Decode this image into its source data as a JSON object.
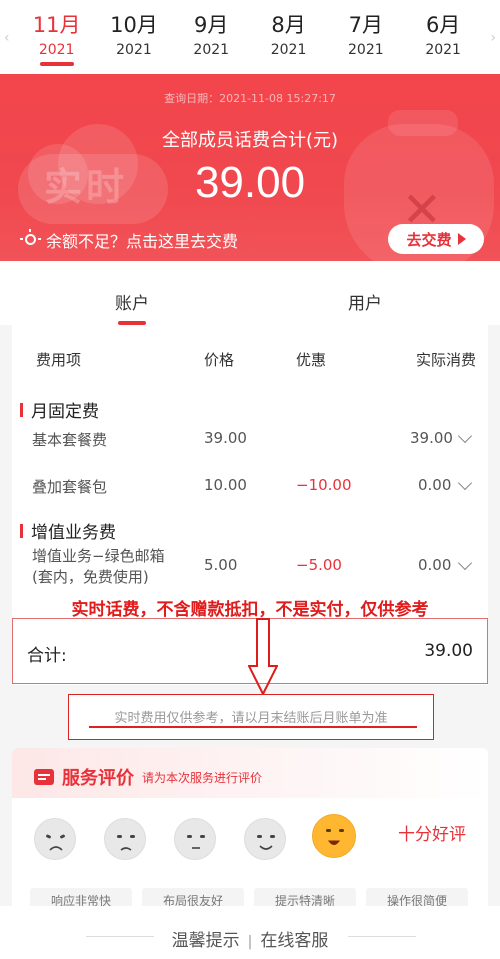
{
  "months": [
    {
      "month": "11月",
      "year": "2021",
      "active": true
    },
    {
      "month": "10月",
      "year": "2021",
      "active": false
    },
    {
      "month": "9月",
      "year": "2021",
      "active": false
    },
    {
      "month": "8月",
      "year": "2021",
      "active": false
    },
    {
      "month": "7月",
      "year": "2021",
      "active": false
    },
    {
      "month": "6月",
      "year": "2021",
      "active": false
    }
  ],
  "banner": {
    "query_date": "查询日期：2021-11-08 15:27:17",
    "watermark": "实时",
    "total_label": "全部成员话费合计(元)",
    "total_amount": "39.00",
    "hint": "余额不足？点击这里去交费",
    "pay_button": "去交费"
  },
  "sub_tabs": {
    "account": "账户",
    "user": "用户"
  },
  "bill": {
    "headers": {
      "item": "费用项",
      "price": "价格",
      "discount": "优惠",
      "actual": "实际消费"
    },
    "section_monthly": "月固定费",
    "rows_monthly": [
      {
        "item": "基本套餐费",
        "price": "39.00",
        "discount": "",
        "actual": "39.00"
      },
      {
        "item": "叠加套餐包",
        "price": "10.00",
        "discount": "−10.00",
        "actual": "0.00"
      }
    ],
    "section_vas": "增值业务费",
    "rows_vas": [
      {
        "item_line1": "增值业务−绿色邮箱",
        "item_line2": "(套内，免费使用)",
        "price": "5.00",
        "discount": "−5.00",
        "actual": "0.00"
      }
    ],
    "annotation": "实时话费，不含赠款抵扣，不是实付，仅供参考",
    "total_label": "合计:",
    "total_value": "39.00"
  },
  "note": "实时费用仅供参考，请以月末结账后月账单为准",
  "rating": {
    "title": "服务评价",
    "subtitle": "请为本次服务进行评价",
    "best_label": "十分好评",
    "tags": [
      "响应非常快",
      "布局很友好",
      "提示特清晰",
      "操作很简便"
    ]
  },
  "bottom": {
    "tips": "温馨提示",
    "service": "在线客服"
  },
  "colors": {
    "accent": "#e8323a",
    "annotation": "#e01b1b"
  }
}
